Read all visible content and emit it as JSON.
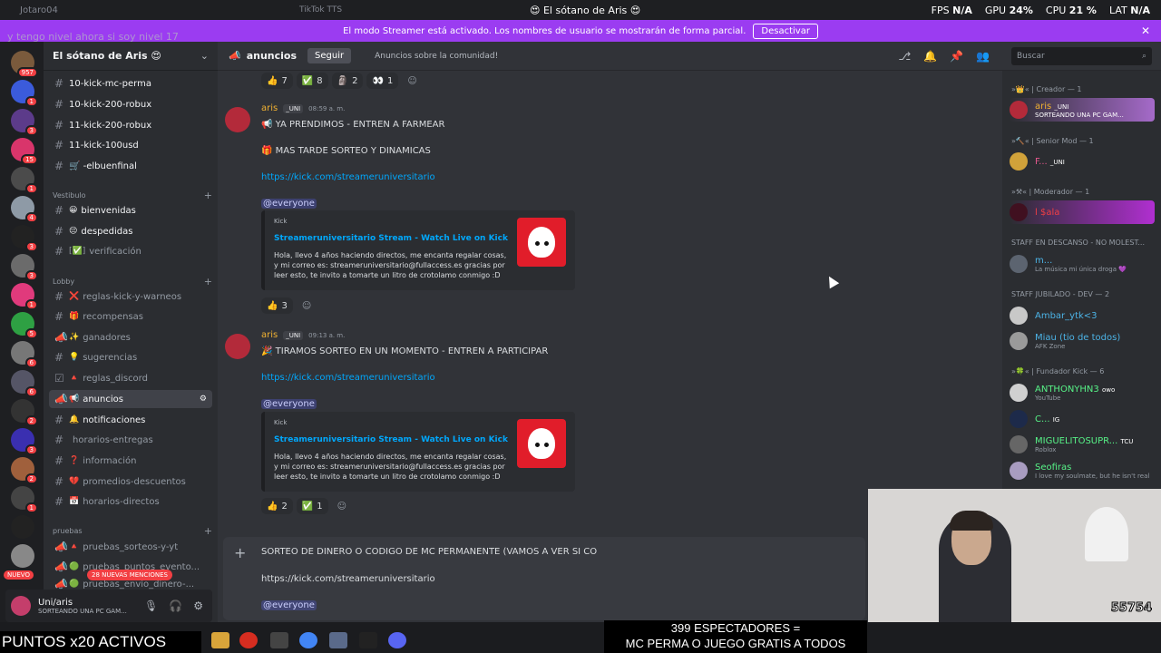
{
  "titlebar": {
    "left": "Jotaro04",
    "mid": "TikTok TTS",
    "center": "😍 El sótano de Aris 😍",
    "fps_label": "FPS",
    "fps": "N/A",
    "gpu_label": "GPU",
    "gpu": "24%",
    "cpu_label": "CPU",
    "cpu": "21 %",
    "lat_label": "LAT",
    "lat": "N/A"
  },
  "streamer_bar": {
    "text": "El modo Streamer está activado. Los nombres de usuario se mostrarán de forma parcial.",
    "button": "Desactivar"
  },
  "overlay_text": "y tengo nivel ahora si soy nivel 17",
  "servers": {
    "badges": [
      "957",
      "1",
      "3",
      "15",
      "1",
      "4",
      "3",
      "3",
      "1",
      "5",
      "6",
      "6",
      "2",
      "3",
      "2",
      "1"
    ],
    "nuevo": "NUEVO"
  },
  "guild": {
    "name": "El sótano de Aris 😍",
    "channels": [
      {
        "name": "10-kick-mc-perma"
      },
      {
        "name": "10-kick-200-robux"
      },
      {
        "name": "11-kick-200-robux"
      },
      {
        "name": "11-kick-100usd"
      },
      {
        "name": "🛒 -elbuenfinal"
      }
    ],
    "cat_vestibulo": "Vestibulo",
    "vestibulo": [
      {
        "name": "bienvenidas",
        "emoji": "😀"
      },
      {
        "name": "despedidas",
        "emoji": "😔"
      },
      {
        "name": "verificación",
        "emoji": "[✅]"
      }
    ],
    "cat_lobby": "Lobby",
    "lobby": [
      {
        "name": "reglas-kick-y-warneos",
        "emoji": "❌"
      },
      {
        "name": "recompensas",
        "emoji": "🎁"
      },
      {
        "name": "ganadores",
        "emoji": "✨"
      },
      {
        "name": "sugerencias",
        "emoji": "💡"
      },
      {
        "name": "reglas_discord",
        "emoji": "🔺"
      },
      {
        "name": "anuncios",
        "emoji": "📢"
      },
      {
        "name": "notificaciones",
        "emoji": "🔔"
      },
      {
        "name": "horarios-entregas",
        "emoji": ""
      },
      {
        "name": "información",
        "emoji": "❓"
      },
      {
        "name": "promedios-descuentos",
        "emoji": "💔"
      },
      {
        "name": "horarios-directos",
        "emoji": "📅"
      }
    ],
    "cat_pruebas": "pruebas",
    "pruebas": [
      {
        "name": "pruebas_sorteos-y-yt",
        "emoji": "🔺"
      },
      {
        "name": "pruebas_puntos_evento...",
        "emoji": "🟢"
      },
      {
        "name": "pruebas_envio_dinero-...",
        "emoji": "🟢"
      }
    ],
    "mentions": "28 NUEVAS MENCIONES"
  },
  "user": {
    "name": "Uni/aris",
    "status": "SORTEANDO UNA PC GAM..."
  },
  "channel_header": {
    "name": "anuncios",
    "follow": "Seguir",
    "description": "Anuncios sobre la comunidad!"
  },
  "search": {
    "placeholder": "Buscar"
  },
  "top_reactions": [
    {
      "emoji": "👍",
      "count": "7"
    },
    {
      "emoji": "✅",
      "count": "8"
    },
    {
      "emoji": "🗿",
      "count": "2"
    },
    {
      "emoji": "👀",
      "count": "1"
    }
  ],
  "messages": [
    {
      "author": "aris",
      "tag": "_UNI",
      "time": "08:59 a. m.",
      "lines": [
        "📢 YA PRENDIMOS - ENTREN A FARMEAR",
        "🎁 MAS TARDE SORTEO Y DINAMICAS"
      ],
      "link": "https://kick.com/streameruniversitario",
      "mention": "@everyone",
      "embed": {
        "provider": "Kick",
        "title": "Streameruniversitario Stream - Watch Live on Kick",
        "desc": "Hola, llevo 4 años haciendo directos, me encanta regalar cosas, y mi correo es: streameruniversitario@fullaccess.es gracias por leer esto, te invito a tomarte un litro de crotolamo conmigo :D"
      },
      "reactions": [
        {
          "emoji": "👍",
          "count": "3"
        }
      ]
    },
    {
      "author": "aris",
      "tag": "_UNI",
      "time": "09:13 a. m.",
      "lines": [
        "🎉 TIRAMOS SORTEO EN UN MOMENTO - ENTREN A PARTICIPAR"
      ],
      "link": "https://kick.com/streameruniversitario",
      "mention": "@everyone",
      "embed": {
        "provider": "Kick",
        "title": "Streameruniversitario Stream - Watch Live on Kick",
        "desc": "Hola, llevo 4 años haciendo directos, me encanta regalar cosas, y mi correo es: streameruniversitario@fullaccess.es gracias por leer esto, te invito a tomarte un litro de crotolamo conmigo :D"
      },
      "reactions": [
        {
          "emoji": "👍",
          "count": "2"
        },
        {
          "emoji": "✅",
          "count": "1"
        }
      ]
    }
  ],
  "composer": {
    "line1": "SORTEO DE DINERO O CODIGO DE MC PERMANENTE (VAMOS A VER SI CO",
    "line2": "https://kick.com/streameruniversitario",
    "line3": "@everyone"
  },
  "members": {
    "g1": "»👑« | Creador — 1",
    "m1": {
      "name": "aris",
      "tag": "_UNI",
      "status": "SORTEANDO UNA PC GAM..."
    },
    "g2": "»🔨« | Senior Mod — 1",
    "m2": {
      "name": "F...",
      "tag": "_UNI"
    },
    "g3": "»⚒« | Moderador — 1",
    "m3": {
      "name": "l $ala"
    },
    "g4": "STAFF EN DESCANSO - NO MOLEST...",
    "m4": {
      "name": "m...",
      "status": "La música mi única droga 💜"
    },
    "g5": "STAFF JUBILADO - DEV — 2",
    "m5": {
      "name": "Ambar_ytk<3"
    },
    "m6": {
      "name": "Miau (tio de todos)",
      "status": "AFK Zone"
    },
    "g6": "»🍀« | Fundador Kick — 6",
    "m7": {
      "name": "ANTHONYHN3",
      "tag": "owo",
      "status": "YouTube"
    },
    "m8": {
      "name": "C...",
      "tag": "IG"
    },
    "m9": {
      "name": "MIGUELITOSUPR...",
      "tag": "TCU",
      "status": "Roblox"
    },
    "m10": {
      "name": "Seofiras",
      "status": "I love my soulmate, but he isn't real"
    }
  },
  "webcam": {
    "count": "55754"
  },
  "overlay_bottom": {
    "puntos": "PUNTOS x20 ACTIVOS",
    "spect1": "399 ESPECTADORES =",
    "spect2": "MC PERMA O JUEGO GRATIS A TODOS"
  },
  "colors": {
    "streamer_bar": "#9b3cf1",
    "author": "#f0b132",
    "link": "#00a8fc",
    "sidebar": "#2b2d31",
    "chat": "#313338"
  }
}
